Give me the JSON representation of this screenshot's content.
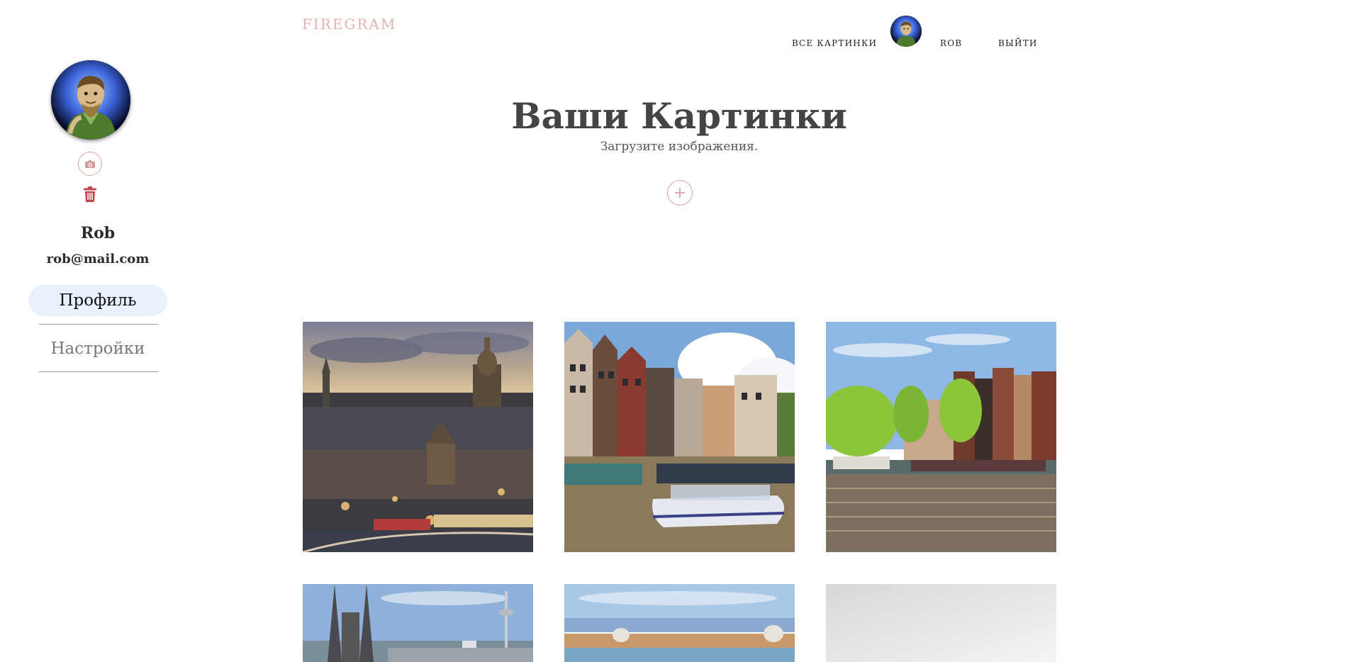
{
  "header": {
    "logo": "FIREGRAM",
    "nav_all_pictures": "ВСЕ КАРТИНКИ",
    "nav_username": "ROB",
    "nav_logout": "ВЫЙТИ",
    "avatar_icon": "user-avatar"
  },
  "sidebar": {
    "user_name": "Rob",
    "user_email": "rob@mail.com",
    "nav_profile": "Профиль",
    "nav_settings": "Настройки",
    "upload_photo_icon": "camera-icon",
    "delete_photo_icon": "trash-icon"
  },
  "main": {
    "title": "Ваши Картинки",
    "subtitle": "Загрузите изображения.",
    "add_button_symbol": "+"
  },
  "gallery": {
    "images": [
      {
        "subject": "amsterdam-dusk-cityscape"
      },
      {
        "subject": "amsterdam-canal-boats"
      },
      {
        "subject": "amsterdam-canal-houses"
      },
      {
        "subject": "cologne-cathedral-skyline"
      },
      {
        "subject": "venice-coastline"
      },
      {
        "subject": "white-gradient"
      }
    ]
  },
  "colors": {
    "accent": "#dba3a3",
    "logo": "#e4b3ad",
    "trash": "#c4434b",
    "active_nav_bg": "#e9f2fc"
  }
}
